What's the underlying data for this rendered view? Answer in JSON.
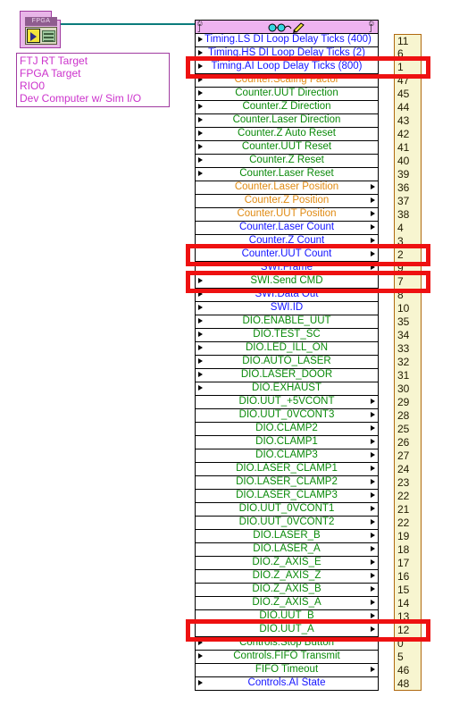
{
  "node": {
    "type_label": "FPGA",
    "icon": "fpga-chip-icon",
    "wire_color": "#0b7b7b"
  },
  "target_info": {
    "lines": [
      "FTJ RT Target",
      "FPGA Target",
      "RIO0",
      "Dev Computer w/ Sim I/O"
    ],
    "text_color": "#cc33cc"
  },
  "io_panel": {
    "header": {
      "left_glyph_top": "⬚",
      "left_glyph_bottom": "⬚",
      "right_glyph_top": "⬚",
      "right_glyph_bottom": "⬚",
      "icons": [
        "glasses-icon",
        "pencil-icon"
      ],
      "background": "#eeb3f0"
    },
    "colors": {
      "blue": "#1414ff",
      "green": "#0a8a0a",
      "orange": "#e08a12",
      "highlight": "#ee1111",
      "number_bg": "#f7f5d0",
      "number_border": "#b06a10"
    },
    "rows": [
      {
        "label": "Timing.LS DI Loop Delay Ticks (400)",
        "number": "11",
        "color": "blue",
        "arrow": "left"
      },
      {
        "label": "Timing.HS DI Loop Delay Ticks (2)",
        "number": "6",
        "color": "blue",
        "arrow": "left"
      },
      {
        "label": "Timing.AI Loop Delay Ticks (800)",
        "number": "1",
        "color": "blue",
        "arrow": "left",
        "highlighted": true
      },
      {
        "label": "Counter.Scaling Factor",
        "number": "47",
        "color": "orange",
        "arrow": "left"
      },
      {
        "label": "Counter.UUT Direction",
        "number": "45",
        "color": "green",
        "arrow": "left"
      },
      {
        "label": "Counter.Z Direction",
        "number": "44",
        "color": "green",
        "arrow": "left"
      },
      {
        "label": "Counter.Laser Direction",
        "number": "43",
        "color": "green",
        "arrow": "left"
      },
      {
        "label": "Counter.Z Auto Reset",
        "number": "42",
        "color": "green",
        "arrow": "left"
      },
      {
        "label": "Counter.UUT Reset",
        "number": "41",
        "color": "green",
        "arrow": "left"
      },
      {
        "label": "Counter.Z Reset",
        "number": "40",
        "color": "green",
        "arrow": "left"
      },
      {
        "label": "Counter.Laser Reset",
        "number": "39",
        "color": "green",
        "arrow": "left"
      },
      {
        "label": "Counter.Laser Position",
        "number": "36",
        "color": "orange",
        "arrow": "right"
      },
      {
        "label": "Counter.Z Position",
        "number": "37",
        "color": "orange",
        "arrow": "right"
      },
      {
        "label": "Counter.UUT Position",
        "number": "38",
        "color": "orange",
        "arrow": "right"
      },
      {
        "label": "Counter.Laser Count",
        "number": "4",
        "color": "blue",
        "arrow": "right"
      },
      {
        "label": "Counter.Z Count",
        "number": "3",
        "color": "blue",
        "arrow": "right"
      },
      {
        "label": "Counter.UUT Count",
        "number": "2",
        "color": "blue",
        "arrow": "right",
        "highlighted": true
      },
      {
        "label": "SWI.Frame",
        "number": "9",
        "color": "blue",
        "arrow": "right"
      },
      {
        "label": "SWI.Send CMD",
        "number": "7",
        "color": "green",
        "arrow": "left",
        "highlighted": true
      },
      {
        "label": "SWI.Data Out",
        "number": "8",
        "color": "blue",
        "arrow": "left"
      },
      {
        "label": "SWI.ID",
        "number": "10",
        "color": "blue",
        "arrow": "left"
      },
      {
        "label": "DIO.ENABLE_UUT",
        "number": "35",
        "color": "green",
        "arrow": "left"
      },
      {
        "label": "DIO.TEST_SC",
        "number": "34",
        "color": "green",
        "arrow": "left"
      },
      {
        "label": "DIO.LED_ILL_ON",
        "number": "33",
        "color": "green",
        "arrow": "left"
      },
      {
        "label": "DIO.AUTO_LASER",
        "number": "32",
        "color": "green",
        "arrow": "left"
      },
      {
        "label": "DIO.LASER_DOOR",
        "number": "31",
        "color": "green",
        "arrow": "left"
      },
      {
        "label": "DIO.EXHAUST",
        "number": "30",
        "color": "green",
        "arrow": "left"
      },
      {
        "label": "DIO.UUT_+5VCONT",
        "number": "29",
        "color": "green",
        "arrow": "right"
      },
      {
        "label": "DIO.UUT_0VCONT3",
        "number": "28",
        "color": "green",
        "arrow": "right"
      },
      {
        "label": "DIO.CLAMP2",
        "number": "25",
        "color": "green",
        "arrow": "right"
      },
      {
        "label": "DIO.CLAMP1",
        "number": "26",
        "color": "green",
        "arrow": "right"
      },
      {
        "label": "DIO.CLAMP3",
        "number": "27",
        "color": "green",
        "arrow": "right"
      },
      {
        "label": "DIO.LASER_CLAMP1",
        "number": "24",
        "color": "green",
        "arrow": "right"
      },
      {
        "label": "DIO.LASER_CLAMP2",
        "number": "23",
        "color": "green",
        "arrow": "right"
      },
      {
        "label": "DIO.LASER_CLAMP3",
        "number": "22",
        "color": "green",
        "arrow": "right"
      },
      {
        "label": "DIO.UUT_0VCONT1",
        "number": "21",
        "color": "green",
        "arrow": "right"
      },
      {
        "label": "DIO.UUT_0VCONT2",
        "number": "22",
        "color": "green",
        "arrow": "right"
      },
      {
        "label": "DIO.LASER_B",
        "number": "19",
        "color": "green",
        "arrow": "right"
      },
      {
        "label": "DIO.LASER_A",
        "number": "18",
        "color": "green",
        "arrow": "right"
      },
      {
        "label": "DIO.Z_AXIS_E",
        "number": "17",
        "color": "green",
        "arrow": "right"
      },
      {
        "label": "DIO.Z_AXIS_Z",
        "number": "16",
        "color": "green",
        "arrow": "right"
      },
      {
        "label": "DIO.Z_AXIS_B",
        "number": "15",
        "color": "green",
        "arrow": "right"
      },
      {
        "label": "DIO.Z_AXIS_A",
        "number": "14",
        "color": "green",
        "arrow": "right"
      },
      {
        "label": "DIO.UUT_B",
        "number": "13",
        "color": "green",
        "arrow": "right"
      },
      {
        "label": "DIO.UUT_A",
        "number": "12",
        "color": "green",
        "arrow": "right",
        "highlighted": true
      },
      {
        "label": "Controls.Stop Button",
        "number": "0",
        "color": "green",
        "arrow": "left"
      },
      {
        "label": "Controls.FIFO Transmit",
        "number": "5",
        "color": "green",
        "arrow": "left"
      },
      {
        "label": "FIFO Timeout",
        "number": "46",
        "color": "green",
        "arrow": "right"
      },
      {
        "label": "Controls.AI State",
        "number": "48",
        "color": "blue",
        "arrow": "left"
      }
    ]
  }
}
